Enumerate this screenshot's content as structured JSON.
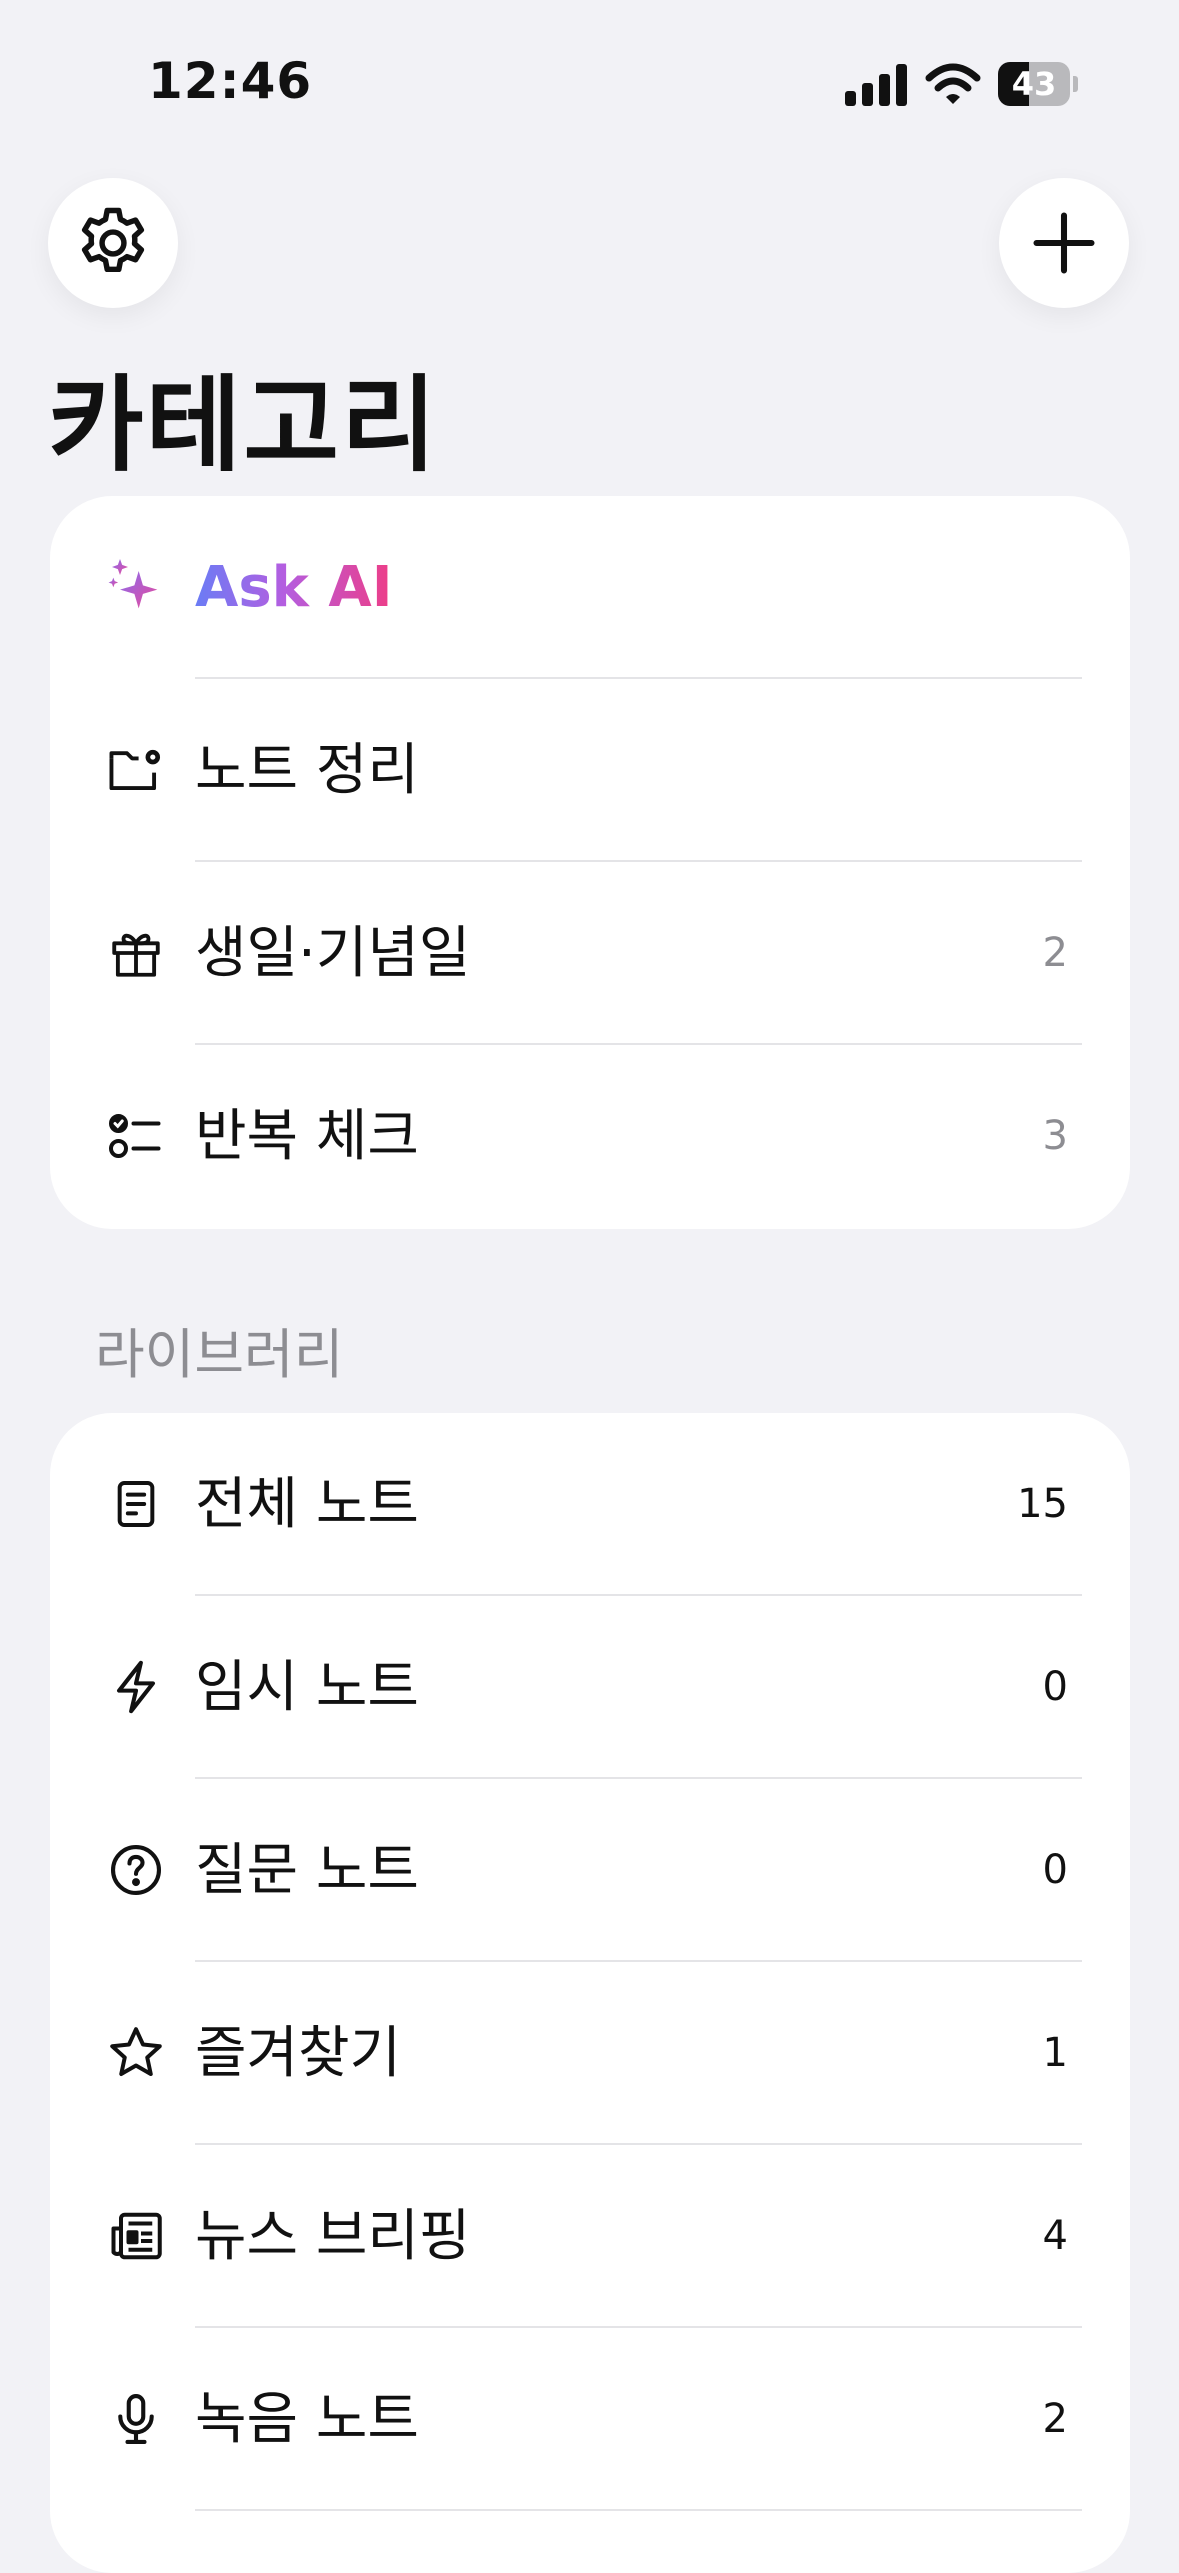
{
  "status_bar": {
    "time": "12:46",
    "battery": "43"
  },
  "header": {
    "settings_icon": "gear-icon",
    "add_icon": "plus-icon",
    "title": "카테고리"
  },
  "categories": [
    {
      "icon": "sparkles-icon",
      "label": "Ask AI",
      "count": ""
    },
    {
      "icon": "folder-gear-icon",
      "label": "노트 정리",
      "count": ""
    },
    {
      "icon": "gift-icon",
      "label": "생일·기념일",
      "count": "2"
    },
    {
      "icon": "checklist-icon",
      "label": "반복 체크",
      "count": "3"
    }
  ],
  "library": {
    "title": "라이브러리",
    "items": [
      {
        "icon": "document-icon",
        "label": "전체 노트",
        "count": "15"
      },
      {
        "icon": "bolt-icon",
        "label": "임시 노트",
        "count": "0"
      },
      {
        "icon": "question-circle-icon",
        "label": "질문 노트",
        "count": "0"
      },
      {
        "icon": "star-icon",
        "label": "즐겨찾기",
        "count": "1"
      },
      {
        "icon": "newspaper-icon",
        "label": "뉴스 브리핑",
        "count": "4"
      },
      {
        "icon": "microphone-icon",
        "label": "녹음 노트",
        "count": "2"
      }
    ]
  }
}
